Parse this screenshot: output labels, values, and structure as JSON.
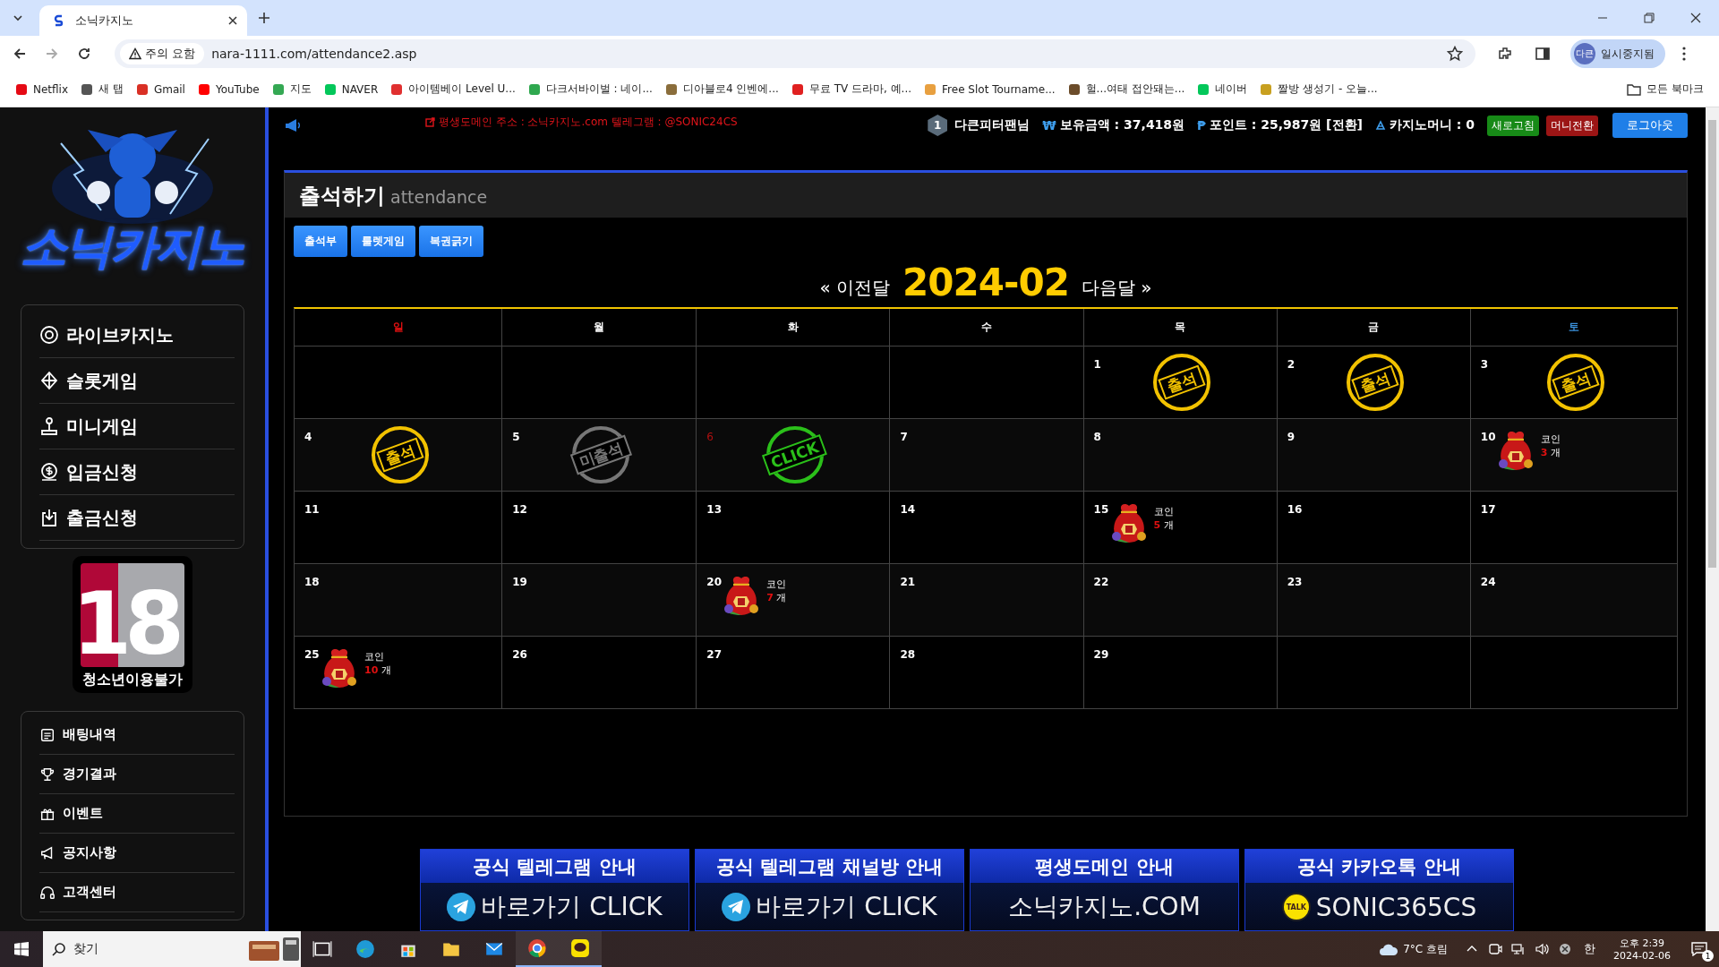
{
  "browser": {
    "tab_title": "소닉카지노",
    "security_label": "주의 요함",
    "url": "nara-1111.com/attendance2.asp",
    "profile_initials": "다큰",
    "profile_status": "일시중지됨",
    "bookmarks": [
      "Netflix",
      "새 탭",
      "Gmail",
      "YouTube",
      "지도",
      "NAVER",
      "아이템베이 Level U...",
      "다크서바이벌 : 네이...",
      "디아블로4 인벤에...",
      "무료 TV 드라마, 예...",
      "Free Slot Tourname...",
      "헐...여태 접안돼는...",
      "네이버",
      "짤방 생성기 - 오늘..."
    ],
    "all_bookmarks": "모든 북마크"
  },
  "site": {
    "logo": "소닉카지노",
    "notice": "평생도메인 주소 : 소닉카지노.com 텔레그램 : @SONIC24CS",
    "user": {
      "level": "1",
      "name": "다큰피터팬님"
    },
    "balances": [
      {
        "kind": "symbol",
        "symbol": "₩",
        "text": "보유금액 : 37,418원"
      },
      {
        "kind": "symbol",
        "symbol": "₱",
        "text": "포인트 : 25,987원 [전환]"
      },
      {
        "kind": "casino",
        "text": "카지노머니 : 0"
      }
    ],
    "header_buttons": [
      {
        "label": "새로고침",
        "color": "#178a17"
      },
      {
        "label": "머니전환",
        "color": "#9c1515"
      },
      {
        "label": "로그아웃",
        "color": "#1f7fe8"
      }
    ],
    "main_menu": [
      "라이브카지노",
      "슬롯게임",
      "미니게임",
      "입금신청",
      "출금신청"
    ],
    "age_badge": {
      "number": "18",
      "label": "청소년이용불가"
    },
    "sub_menu": [
      "배팅내역",
      "경기결과",
      "이벤트",
      "공지사항",
      "고객센터"
    ]
  },
  "attendance": {
    "title": "출석하기",
    "subtitle": "attendance",
    "buttons": [
      "출석부",
      "룰렛게임",
      "복권긁기"
    ],
    "prev": "« 이전달",
    "month": "2024-02",
    "next": "다음달 »",
    "weekdays": [
      {
        "label": "일",
        "color": "#e01010"
      },
      {
        "label": "월",
        "color": "#ffffff"
      },
      {
        "label": "화",
        "color": "#ffffff"
      },
      {
        "label": "수",
        "color": "#ffffff"
      },
      {
        "label": "목",
        "color": "#ffffff"
      },
      {
        "label": "금",
        "color": "#ffffff"
      },
      {
        "label": "토",
        "color": "#3a8fd8"
      }
    ],
    "weeks": [
      [
        {
          "kind": "empty"
        },
        {
          "kind": "empty"
        },
        {
          "kind": "empty"
        },
        {
          "kind": "empty"
        },
        {
          "kind": "day",
          "day": "1",
          "today": false,
          "stamp": {
            "kind": "attended",
            "text": "출석"
          }
        },
        {
          "kind": "day",
          "day": "2",
          "today": false,
          "stamp": {
            "kind": "attended",
            "text": "출석"
          }
        },
        {
          "kind": "day",
          "day": "3",
          "today": false,
          "stamp": {
            "kind": "attended",
            "text": "출석"
          }
        }
      ],
      [
        {
          "kind": "day",
          "day": "4",
          "today": false,
          "stamp": {
            "kind": "attended",
            "text": "출석"
          }
        },
        {
          "kind": "day",
          "day": "5",
          "today": false,
          "stamp": {
            "kind": "absent",
            "text": "미출석"
          }
        },
        {
          "kind": "day",
          "day": "6",
          "today": true,
          "stamp": {
            "kind": "click",
            "text": "CLICK"
          }
        },
        {
          "kind": "day",
          "day": "7",
          "today": false
        },
        {
          "kind": "day",
          "day": "8",
          "today": false
        },
        {
          "kind": "day",
          "day": "9",
          "today": false
        },
        {
          "kind": "day",
          "day": "10",
          "today": false,
          "reward": {
            "label": "코인",
            "count": "3",
            "unit": "개"
          }
        }
      ],
      [
        {
          "kind": "day",
          "day": "11",
          "today": false
        },
        {
          "kind": "day",
          "day": "12",
          "today": false
        },
        {
          "kind": "day",
          "day": "13",
          "today": false
        },
        {
          "kind": "day",
          "day": "14",
          "today": false
        },
        {
          "kind": "day",
          "day": "15",
          "today": false,
          "reward": {
            "label": "코인",
            "count": "5",
            "unit": "개"
          }
        },
        {
          "kind": "day",
          "day": "16",
          "today": false
        },
        {
          "kind": "day",
          "day": "17",
          "today": false
        }
      ],
      [
        {
          "kind": "day",
          "day": "18",
          "today": false
        },
        {
          "kind": "day",
          "day": "19",
          "today": false
        },
        {
          "kind": "day",
          "day": "20",
          "today": false,
          "reward": {
            "label": "코인",
            "count": "7",
            "unit": "개"
          }
        },
        {
          "kind": "day",
          "day": "21",
          "today": false
        },
        {
          "kind": "day",
          "day": "22",
          "today": false
        },
        {
          "kind": "day",
          "day": "23",
          "today": false
        },
        {
          "kind": "day",
          "day": "24",
          "today": false
        }
      ],
      [
        {
          "kind": "day",
          "day": "25",
          "today": false,
          "reward": {
            "label": "코인",
            "count": "10",
            "unit": "개"
          }
        },
        {
          "kind": "day",
          "day": "26",
          "today": false
        },
        {
          "kind": "day",
          "day": "27",
          "today": false
        },
        {
          "kind": "day",
          "day": "28",
          "today": false
        },
        {
          "kind": "day",
          "day": "29",
          "today": false
        },
        {
          "kind": "empty"
        },
        {
          "kind": "empty"
        }
      ]
    ]
  },
  "banners": [
    {
      "kind": "telegram",
      "title": "공식 텔레그램 안내",
      "text": "바로가기 CLICK"
    },
    {
      "kind": "telegram",
      "title": "공식 텔레그램 채널방 안내",
      "text": "바로가기 CLICK"
    },
    {
      "kind": "plain",
      "title": "평생도메인 안내",
      "text": "소닉카지노.COM"
    },
    {
      "kind": "kakao",
      "title": "공식 카카오톡 안내",
      "badge": "TALK",
      "text": "SONIC365CS"
    }
  ],
  "taskbar": {
    "search": "찾기",
    "weather": "7°C 흐림",
    "ime": "한",
    "time": "오후 2:39",
    "date": "2024-02-06",
    "notifications": "1"
  }
}
